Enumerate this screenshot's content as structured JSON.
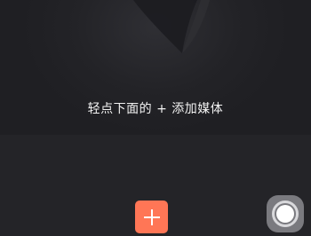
{
  "preview": {
    "hint_text": "轻点下面的 + 添加媒体"
  },
  "toolbar": {
    "add_button_icon": "plus-icon",
    "accent_color": "#ff7656"
  },
  "overlay": {
    "floating_button_icon": "assistive-touch-icon"
  }
}
